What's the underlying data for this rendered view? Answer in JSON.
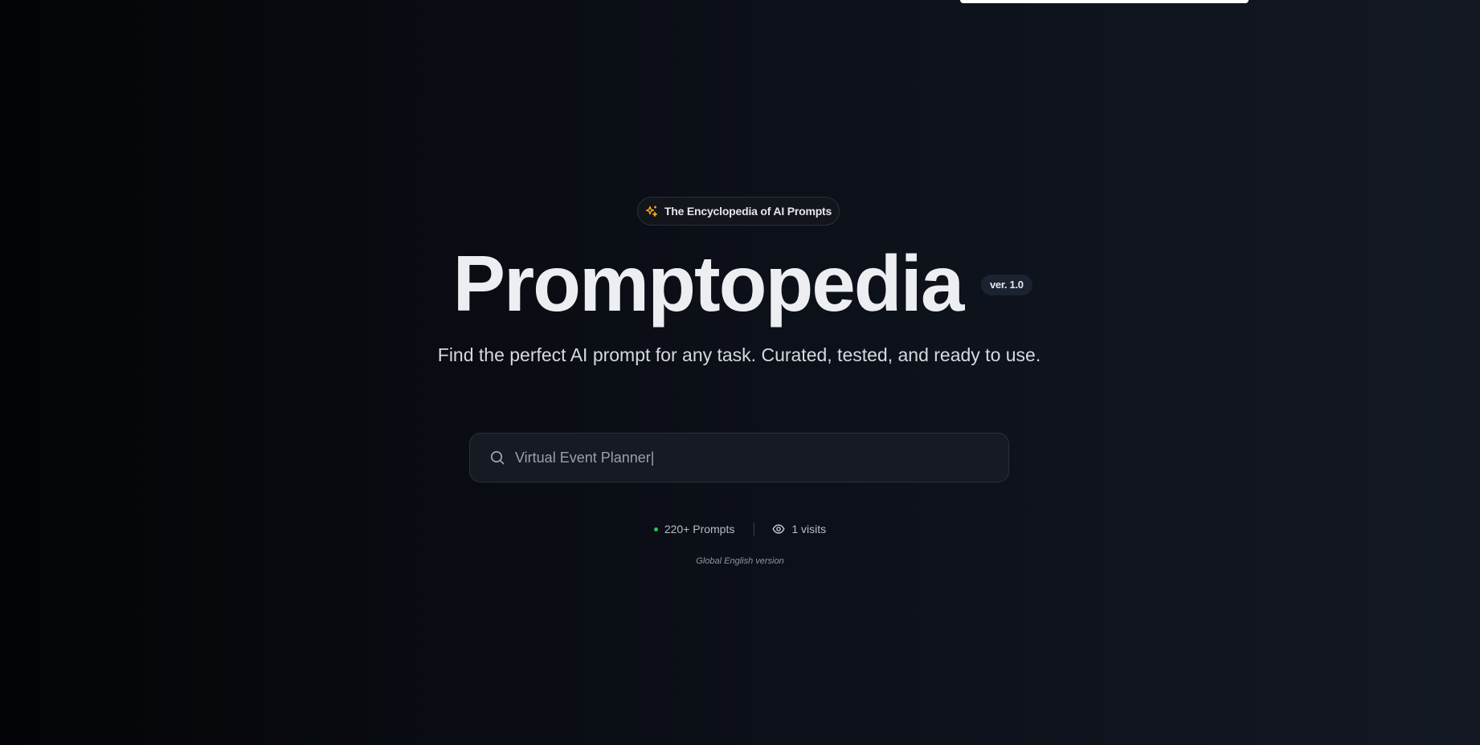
{
  "hero": {
    "tag_label": "The Encyclopedia of AI Prompts",
    "tag_icon": "sparkles-icon",
    "title": "Promptopedia",
    "version_badge": "ver. 1.0",
    "subtitle": "Find the perfect AI prompt for any task. Curated, tested, and ready to use."
  },
  "search": {
    "icon": "search-icon",
    "value": "Virtual Event Planner|"
  },
  "stats": {
    "prompts_count": "220+ Prompts",
    "visits": "1 visits",
    "visits_icon": "eye-icon",
    "status_dot_color": "#22c55e"
  },
  "footer_note": "Global English version",
  "colors": {
    "accent_icon": "#f5a623",
    "background": "#0b0e15"
  }
}
